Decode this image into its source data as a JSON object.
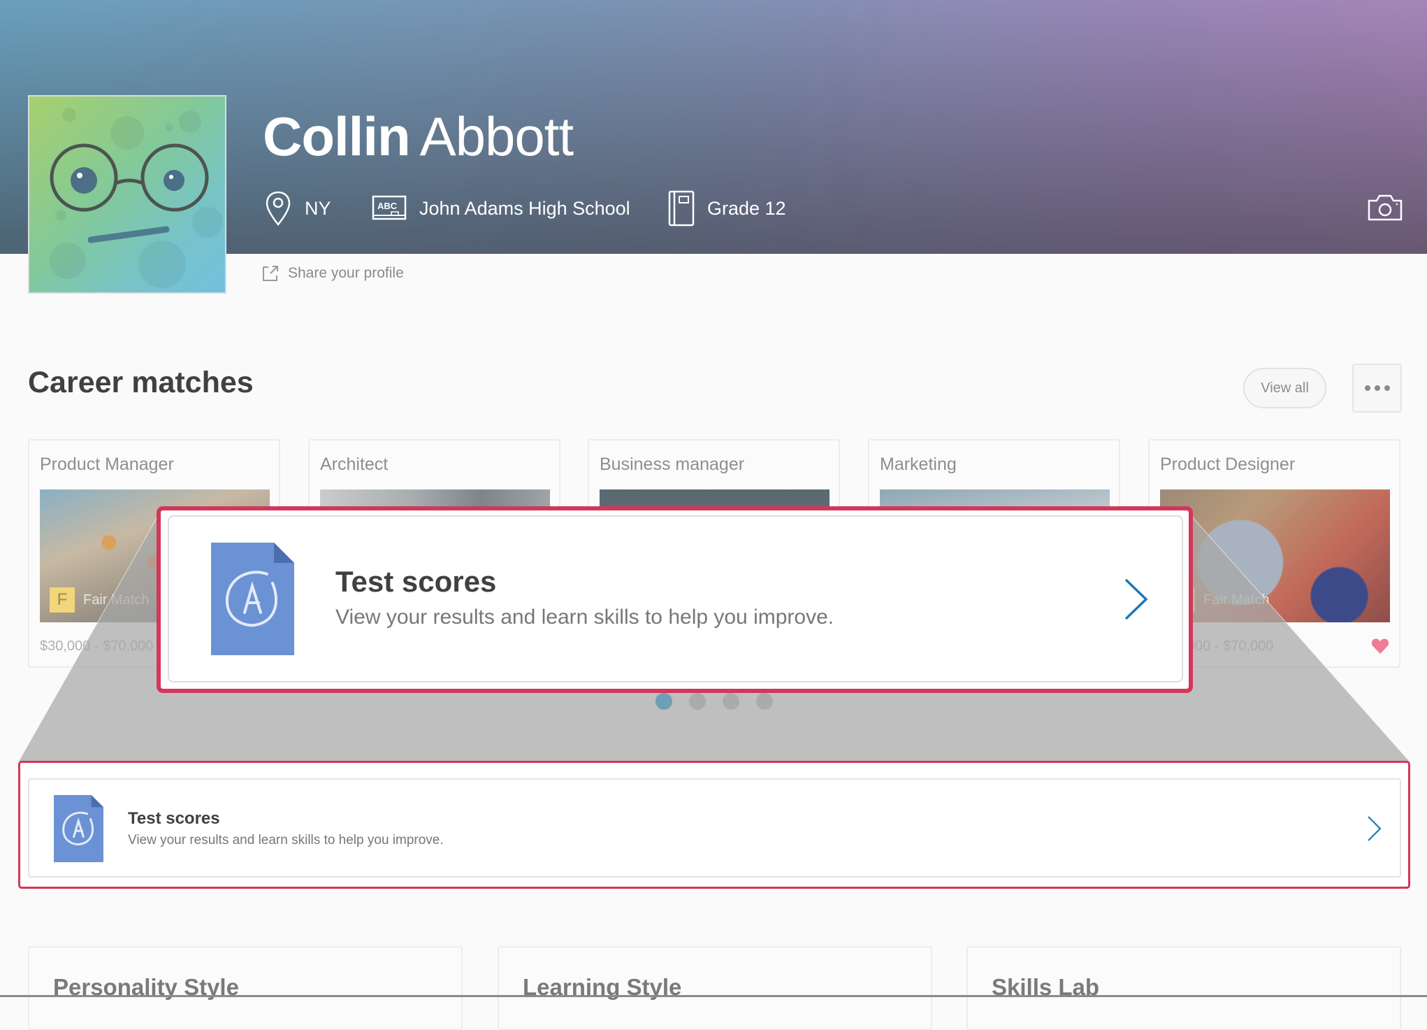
{
  "profile": {
    "first_name": "Collin",
    "last_name": "Abbott",
    "location": "NY",
    "school": "John Adams High School",
    "grade": "Grade 12",
    "share_label": "Share your profile"
  },
  "career_matches": {
    "title": "Career matches",
    "view_all_label": "View all",
    "cards": [
      {
        "title": "Product Manager",
        "match_badge": "F",
        "match_label": "Fair Match",
        "salary": "$30,000 - $70,000",
        "favorited": false
      },
      {
        "title": "Architect",
        "match_badge": "",
        "match_label": "",
        "salary": "",
        "favorited": false
      },
      {
        "title": "Business manager",
        "match_badge": "",
        "match_label": "",
        "salary": "",
        "favorited": false
      },
      {
        "title": "Marketing",
        "match_badge": "",
        "match_label": "",
        "salary": "",
        "favorited": false
      },
      {
        "title": "Product Designer",
        "match_badge": "F",
        "match_label": "Fair Match",
        "salary": "$30,000 - $70,000",
        "favorited": true
      }
    ],
    "carousel": {
      "pages": 4,
      "active_page": 1
    }
  },
  "test_scores": {
    "title": "Test scores",
    "subtitle": "View your results and learn skills to help you improve."
  },
  "bottom_cards": [
    {
      "label": "Personality Style"
    },
    {
      "label": "Learning Style"
    },
    {
      "label": "Skills Lab"
    }
  ],
  "colors": {
    "highlight_border": "#d1385a",
    "accent_blue": "#1f78b4",
    "doc_icon": "#6b92d4",
    "heart": "#f07b92",
    "carousel_active": "#6f9fb5"
  }
}
